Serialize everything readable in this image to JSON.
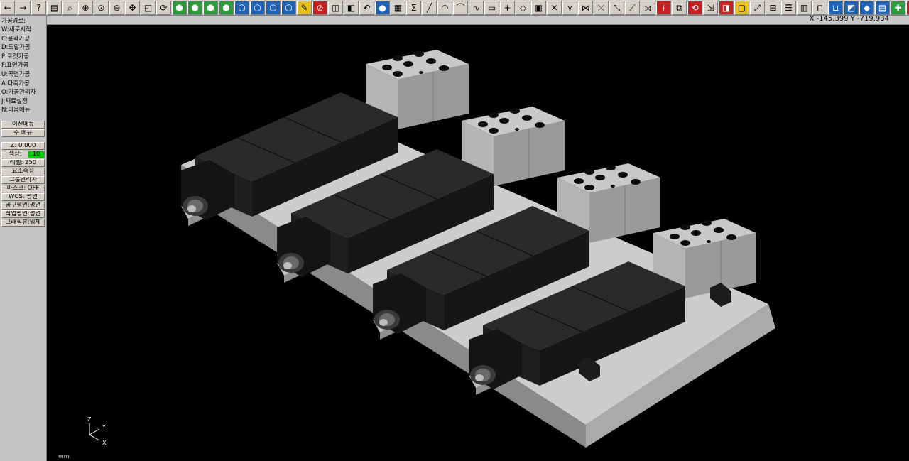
{
  "toolbar": {
    "buttons": [
      {
        "name": "arrow-left",
        "glyph": "←",
        "cls": ""
      },
      {
        "name": "arrow-right",
        "glyph": "→",
        "cls": ""
      },
      {
        "name": "help",
        "glyph": "?",
        "cls": ""
      },
      {
        "name": "notes",
        "glyph": "▤",
        "cls": ""
      },
      {
        "name": "query",
        "glyph": "⌕",
        "cls": ""
      },
      {
        "name": "zoom-window",
        "glyph": "⊕",
        "cls": ""
      },
      {
        "name": "zoom-all",
        "glyph": "⊙",
        "cls": ""
      },
      {
        "name": "zoom-out",
        "glyph": "⊖",
        "cls": ""
      },
      {
        "name": "pan",
        "glyph": "✥",
        "cls": ""
      },
      {
        "name": "zoom-select",
        "glyph": "◰",
        "cls": ""
      },
      {
        "name": "rotate-view",
        "glyph": "⟳",
        "cls": ""
      },
      {
        "name": "view-iso",
        "glyph": "⬢",
        "cls": "gr"
      },
      {
        "name": "view-front",
        "glyph": "⬢",
        "cls": "gr"
      },
      {
        "name": "view-right",
        "glyph": "⬢",
        "cls": "gr"
      },
      {
        "name": "view-top",
        "glyph": "⬢",
        "cls": "gr"
      },
      {
        "name": "view-cube-1",
        "glyph": "⬡",
        "cls": "sq"
      },
      {
        "name": "view-cube-2",
        "glyph": "⬡",
        "cls": "sq"
      },
      {
        "name": "view-cube-3",
        "glyph": "⬡",
        "cls": "sq"
      },
      {
        "name": "view-cube-4",
        "glyph": "⬡",
        "cls": "sq"
      },
      {
        "name": "pencil",
        "glyph": "✎",
        "cls": "yl"
      },
      {
        "name": "no-entry",
        "glyph": "⊘",
        "cls": "rd"
      },
      {
        "name": "layer-a",
        "glyph": "◫",
        "cls": ""
      },
      {
        "name": "layer-b",
        "glyph": "◧",
        "cls": ""
      },
      {
        "name": "undo",
        "glyph": "↶",
        "cls": ""
      },
      {
        "name": "sphere",
        "glyph": "●",
        "cls": "sq"
      },
      {
        "name": "grid",
        "glyph": "▦",
        "cls": ""
      },
      {
        "name": "sigma",
        "glyph": "Σ",
        "cls": ""
      },
      {
        "name": "line",
        "glyph": "╱",
        "cls": ""
      },
      {
        "name": "arc",
        "glyph": "◠",
        "cls": ""
      },
      {
        "name": "curve",
        "glyph": "⌒",
        "cls": ""
      },
      {
        "name": "spline",
        "glyph": "∿",
        "cls": ""
      },
      {
        "name": "rectangle",
        "glyph": "▭",
        "cls": ""
      },
      {
        "name": "point",
        "glyph": "+",
        "cls": ""
      },
      {
        "name": "shape",
        "glyph": "◇",
        "cls": ""
      },
      {
        "name": "box",
        "glyph": "▣",
        "cls": ""
      },
      {
        "name": "trim",
        "glyph": "✕",
        "cls": ""
      },
      {
        "name": "trim-2",
        "glyph": "⋎",
        "cls": ""
      },
      {
        "name": "trim-3",
        "glyph": "⋈",
        "cls": ""
      },
      {
        "name": "cross",
        "glyph": "⤫",
        "cls": ""
      },
      {
        "name": "extend",
        "glyph": "⤡",
        "cls": ""
      },
      {
        "name": "offset",
        "glyph": "⟋",
        "cls": ""
      },
      {
        "name": "mirror",
        "glyph": "⟗",
        "cls": ""
      },
      {
        "name": "measure",
        "glyph": "⟊",
        "cls": "rd"
      },
      {
        "name": "copy",
        "glyph": "⧉",
        "cls": ""
      },
      {
        "name": "rotate",
        "glyph": "⟲",
        "cls": "rd"
      },
      {
        "name": "move",
        "glyph": "⇲",
        "cls": ""
      },
      {
        "name": "select",
        "glyph": "◨",
        "cls": "rd"
      },
      {
        "name": "window",
        "glyph": "▢",
        "cls": "yl"
      },
      {
        "name": "xyz",
        "glyph": "⤢",
        "cls": ""
      },
      {
        "name": "dim",
        "glyph": "⊞",
        "cls": ""
      },
      {
        "name": "panel",
        "glyph": "☰",
        "cls": ""
      },
      {
        "name": "book",
        "glyph": "▥",
        "cls": ""
      },
      {
        "name": "fixture",
        "glyph": "⊓",
        "cls": ""
      },
      {
        "name": "plate",
        "glyph": "⊔",
        "cls": "sq"
      },
      {
        "name": "paint",
        "glyph": "◩",
        "cls": "sq"
      },
      {
        "name": "solid",
        "glyph": "◆",
        "cls": "sq"
      },
      {
        "name": "export",
        "glyph": "▤",
        "cls": "sq"
      },
      {
        "name": "add",
        "glyph": "✚",
        "cls": "gr"
      },
      {
        "name": "exit",
        "glyph": "▮",
        "cls": "rd"
      }
    ]
  },
  "coords": "X -145.399  Y -719.934",
  "sidebar": {
    "section_title": "가공경로:",
    "menu_items": [
      "W:새로시작",
      "C:윤곽가공",
      "D:드릴가공",
      "P:포켓가공",
      "F:표면가공",
      "U:곡면가공",
      "A:다축가공",
      "O:가공관리자",
      "J:재료설정",
      "N:다음메뉴"
    ],
    "prev_menu": "이전메뉴",
    "main_menu": "주 메뉴",
    "z_value": "Z:   0.000",
    "color_label": "색상:",
    "color_value": "10",
    "level": "레벨: 250",
    "attributes": "요소속성",
    "group_manager": "그룹관리자",
    "mask": "마스크:  OFF",
    "wcs": "WCS: 평면",
    "tool_plane": "공구평면:평면",
    "work_plane": "작업평면:평면",
    "graphic_view": "그래픽뷰:입체"
  },
  "axis": {
    "z": "Z",
    "y": "Y",
    "x": "X"
  },
  "units": "mm",
  "colors": {
    "toolbar": "#d4d0c8",
    "sidebar": "#c4c4c4",
    "viewport": "#000000",
    "accent_green": "#00d000"
  }
}
